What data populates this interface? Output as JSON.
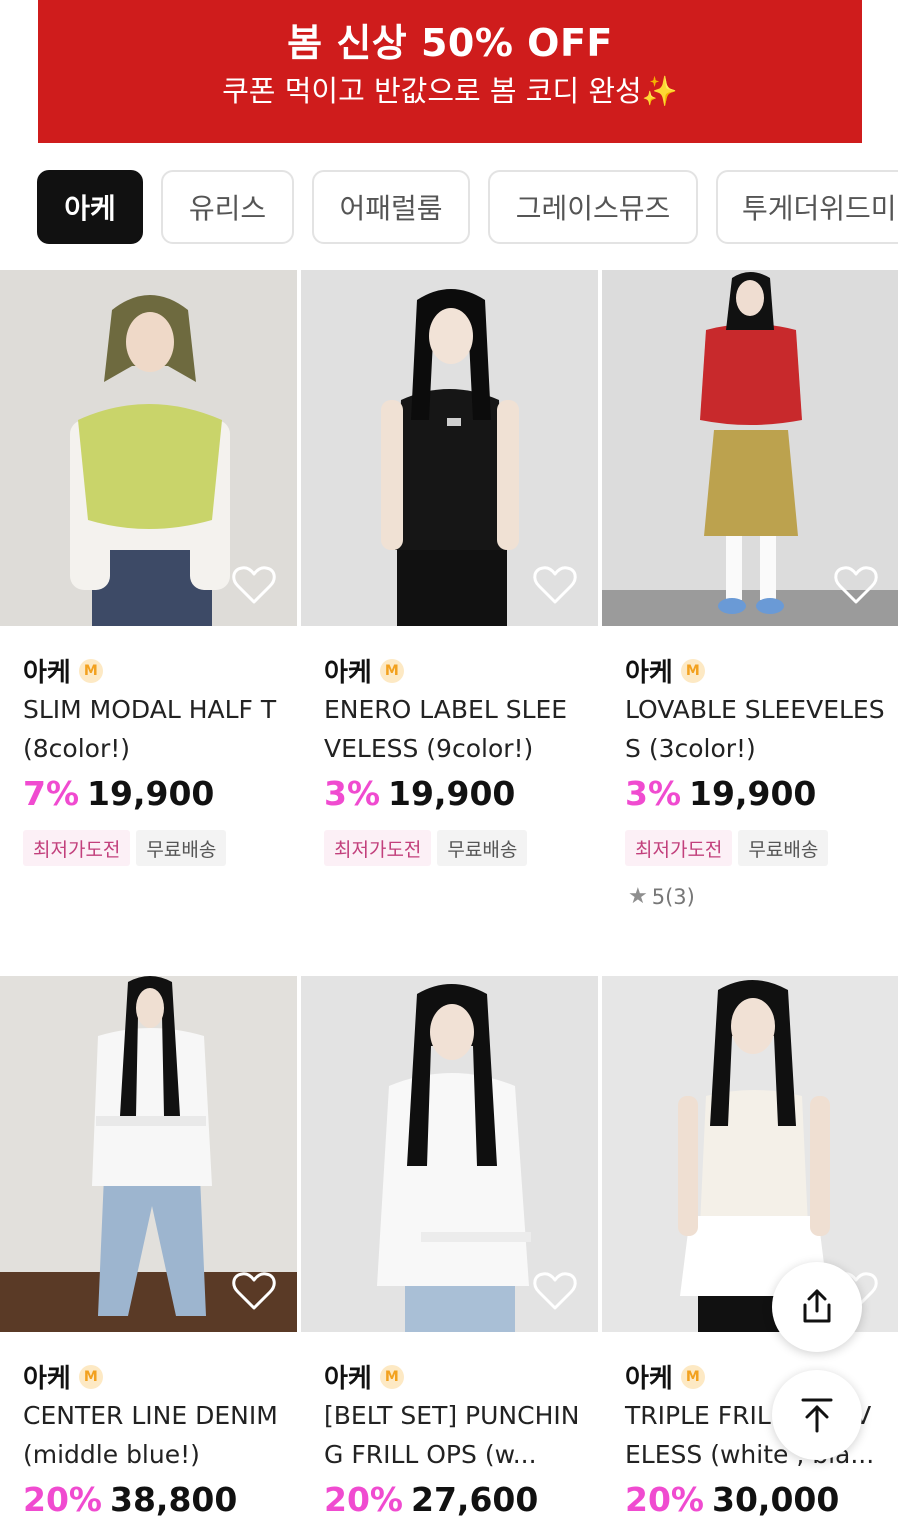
{
  "banner": {
    "title": "봄 신상 50% OFF",
    "subtitle": "쿠폰 먹이고 반값으로 봄 코디 완성✨"
  },
  "brand_chips": [
    "아케",
    "유리스",
    "어패럴룸",
    "그레이스뮤즈",
    "투게더위드미"
  ],
  "active_chip": "아케",
  "colors": {
    "banner_red": "#cf1c1c",
    "discount_pink": "#f04bd0",
    "badge_orange": "#f2a11f"
  },
  "products": [
    {
      "brand": "아케",
      "badge": "M",
      "name": "SLIM MODAL HALF T (8color!)",
      "discount": "7%",
      "price": "19,900",
      "tags": [
        "최저가도전",
        "무료배송"
      ],
      "rating": ""
    },
    {
      "brand": "아케",
      "badge": "M",
      "name": "ENERO LABEL SLEEVELESS (9color!)",
      "discount": "3%",
      "price": "19,900",
      "tags": [
        "최저가도전",
        "무료배송"
      ],
      "rating": ""
    },
    {
      "brand": "아케",
      "badge": "M",
      "name": "LOVABLE SLEEVELESS (3color!)",
      "discount": "3%",
      "price": "19,900",
      "tags": [
        "최저가도전",
        "무료배송"
      ],
      "rating": "5(3)"
    },
    {
      "brand": "아케",
      "badge": "M",
      "name": "CENTER LINE DENIM (middle blue!)",
      "discount": "20%",
      "price": "38,800",
      "tags": [],
      "rating": ""
    },
    {
      "brand": "아케",
      "badge": "M",
      "name": "[BELT SET] PUNCHING FRILL OPS (w...",
      "discount": "20%",
      "price": "27,600",
      "tags": [],
      "rating": ""
    },
    {
      "brand": "아케",
      "badge": "M",
      "name": "TRIPLE FRILL SLEEVELESS (white , bla...",
      "discount": "20%",
      "price": "30,000",
      "tags": [],
      "rating": ""
    }
  ],
  "icons": {
    "wishlist": "heart-outline-icon",
    "share": "share-icon",
    "scroll_top": "arrow-up-to-top-icon",
    "rating": "star-icon"
  }
}
